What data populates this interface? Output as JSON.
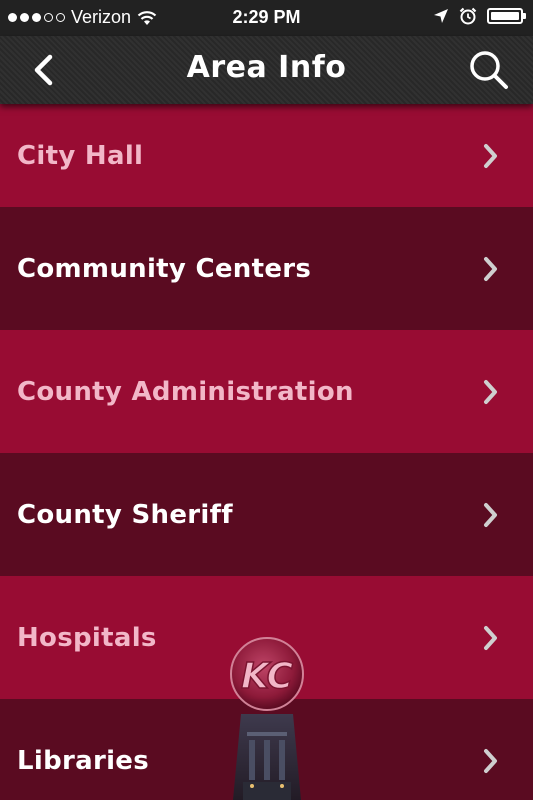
{
  "status_bar": {
    "carrier": "Verizon",
    "time": "2:29 PM",
    "signal_bars_filled": 3,
    "signal_bars_total": 5
  },
  "nav": {
    "title": "Area Info",
    "back_icon": "chevron-left-icon",
    "search_icon": "search-icon"
  },
  "list": {
    "items": [
      {
        "label": "City Hall"
      },
      {
        "label": "Community Centers"
      },
      {
        "label": "County Administration"
      },
      {
        "label": "County Sheriff"
      },
      {
        "label": "Hospitals"
      },
      {
        "label": "Libraries"
      }
    ]
  },
  "logo": {
    "text": "KC"
  },
  "colors": {
    "row_light": "#980c33",
    "row_dark": "#5a0b21",
    "label_light_row": "#f2b7c8",
    "label_dark_row": "#ffffff",
    "nav_bg": "#2a2a2a",
    "chevron": "#cfcfcf"
  }
}
